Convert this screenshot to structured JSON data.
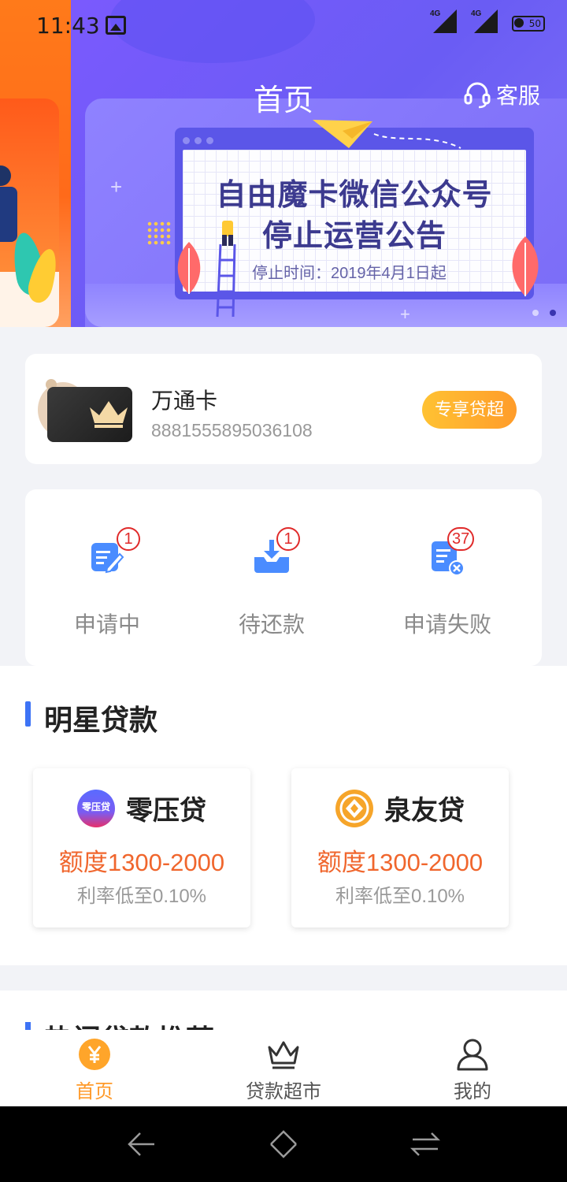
{
  "status_bar": {
    "time": "11:43",
    "signal1": "4G",
    "signal2": "4G",
    "battery": "50"
  },
  "header": {
    "title": "首页",
    "service_label": "客服"
  },
  "banner": {
    "line1": "自由魔卡微信公众号",
    "line2": "停止运营公告",
    "date_text": "停止时间：2019年4月1日起",
    "page_count": 2,
    "active_page": 2
  },
  "card": {
    "name": "万通卡",
    "number": "8881555895036108",
    "button_label": "专享贷超"
  },
  "status": [
    {
      "label": "申请中",
      "count": "1",
      "icon": "edit-document-icon"
    },
    {
      "label": "待还款",
      "count": "1",
      "icon": "download-tray-icon"
    },
    {
      "label": "申请失败",
      "count": "37",
      "icon": "document-error-icon"
    }
  ],
  "star_section": {
    "title": "明星贷款",
    "loans": [
      {
        "name": "零压贷",
        "amount": "额度1300-2000",
        "rate": "利率低至0.10%",
        "logo_text": "零压贷"
      },
      {
        "name": "泉友贷",
        "amount": "额度1300-2000",
        "rate": "利率低至0.10%"
      }
    ]
  },
  "hot_section": {
    "title": "热门贷款推荐"
  },
  "tabbar": {
    "items": [
      {
        "label": "首页",
        "icon": "yen-coin-icon",
        "active": true
      },
      {
        "label": "贷款超市",
        "icon": "crown-icon",
        "active": false
      },
      {
        "label": "我的",
        "icon": "user-icon",
        "active": false
      }
    ]
  },
  "colors": {
    "hero": "#7d59ff",
    "accent_orange": "#ff9a2a",
    "loan_amount": "#f0662d",
    "section_bar": "#3d73f5",
    "badge": "#e02a2a",
    "stat_icon": "#4a8cff"
  }
}
